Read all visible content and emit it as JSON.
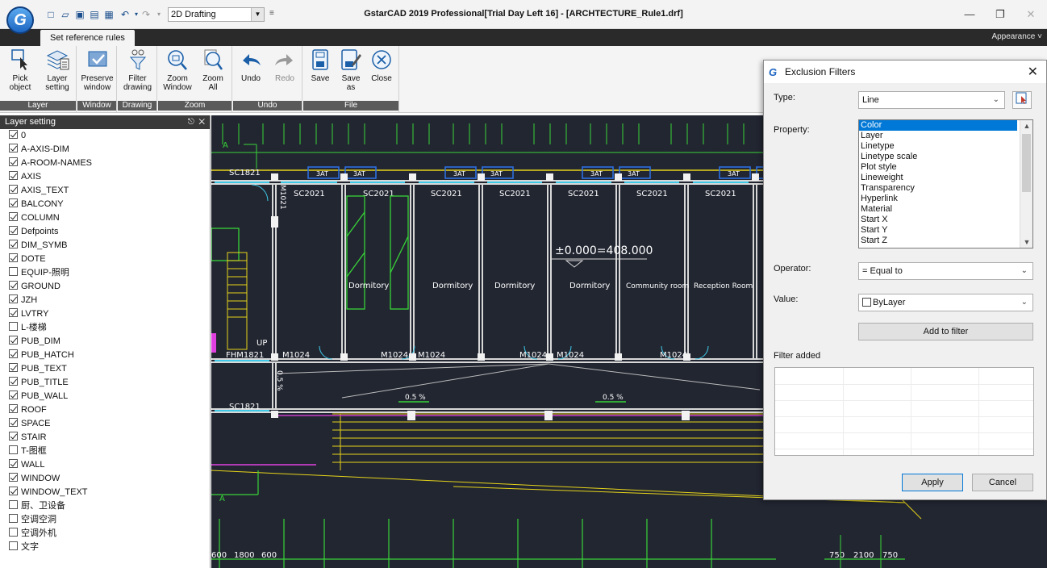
{
  "app": {
    "title": "GstarCAD 2019 Professional[Trial Day Left 16] - [ARCHTECTURE_Rule1.drf]",
    "logo_letter": "G",
    "workspace": "2D Drafting",
    "appearance": "Appearance"
  },
  "ribbon": {
    "active_tab": "Set reference rules",
    "groups": [
      {
        "label": "Layer",
        "buttons": [
          {
            "label": "Pick\nobject",
            "icon": "pick-object-icon"
          },
          {
            "label": "Layer\nsetting",
            "icon": "layer-setting-icon"
          }
        ]
      },
      {
        "label": "Window",
        "buttons": [
          {
            "label": "Preserve\nwindow",
            "icon": "preserve-window-icon"
          }
        ]
      },
      {
        "label": "Drawing",
        "buttons": [
          {
            "label": "Filter\ndrawing",
            "icon": "filter-drawing-icon"
          }
        ]
      },
      {
        "label": "Zoom",
        "buttons": [
          {
            "label": "Zoom\nWindow",
            "icon": "zoom-window-icon"
          },
          {
            "label": "Zoom\nAll",
            "icon": "zoom-all-icon"
          }
        ]
      },
      {
        "label": "Undo",
        "buttons": [
          {
            "label": "Undo",
            "icon": "undo-icon"
          },
          {
            "label": "Redo",
            "icon": "redo-icon"
          }
        ]
      },
      {
        "label": "File",
        "buttons": [
          {
            "label": "Save",
            "icon": "save-icon"
          },
          {
            "label": "Save\nas",
            "icon": "save-as-icon"
          },
          {
            "label": "Close",
            "icon": "close-circle-icon"
          }
        ]
      }
    ]
  },
  "layer_panel": {
    "title": "Layer setting",
    "controls": "➕ ✕",
    "layers": [
      {
        "name": "0",
        "checked": true
      },
      {
        "name": "A-AXIS-DIM",
        "checked": true
      },
      {
        "name": "A-ROOM-NAMES",
        "checked": true
      },
      {
        "name": "AXIS",
        "checked": true
      },
      {
        "name": "AXIS_TEXT",
        "checked": true
      },
      {
        "name": "BALCONY",
        "checked": true
      },
      {
        "name": "COLUMN",
        "checked": true
      },
      {
        "name": "Defpoints",
        "checked": true
      },
      {
        "name": "DIM_SYMB",
        "checked": true
      },
      {
        "name": "DOTE",
        "checked": true
      },
      {
        "name": "EQUIP-照明",
        "checked": false
      },
      {
        "name": "GROUND",
        "checked": true
      },
      {
        "name": "JZH",
        "checked": true
      },
      {
        "name": "LVTRY",
        "checked": true
      },
      {
        "name": "L-楼梯",
        "checked": false
      },
      {
        "name": "PUB_DIM",
        "checked": true
      },
      {
        "name": "PUB_HATCH",
        "checked": true
      },
      {
        "name": "PUB_TEXT",
        "checked": true
      },
      {
        "name": "PUB_TITLE",
        "checked": true
      },
      {
        "name": "PUB_WALL",
        "checked": true
      },
      {
        "name": "ROOF",
        "checked": true
      },
      {
        "name": "SPACE",
        "checked": true
      },
      {
        "name": "STAIR",
        "checked": true
      },
      {
        "name": "T-图框",
        "checked": false
      },
      {
        "name": "WALL",
        "checked": true
      },
      {
        "name": "WINDOW",
        "checked": true
      },
      {
        "name": "WINDOW_TEXT",
        "checked": true
      },
      {
        "name": "厨、卫设备",
        "checked": false
      },
      {
        "name": "空调空洞",
        "checked": false
      },
      {
        "name": "空调外机",
        "checked": false
      },
      {
        "name": "文字",
        "checked": false
      }
    ]
  },
  "drawing": {
    "axis_marks": [
      "A",
      "A"
    ],
    "window_labels_top": [
      "SC1821",
      "SC2021",
      "SC2021",
      "SC2021",
      "SC2021",
      "SC2021",
      "SC2021",
      "SC2021"
    ],
    "window_tags": [
      "3AT",
      "3AT",
      "3AT",
      "3AT",
      "3AT",
      "3AT",
      "3AT",
      "3AT"
    ],
    "vertical_label": "M1021",
    "elevation": "±0.000=408.000",
    "rooms": [
      "Dormitory",
      "Dormitory",
      "Dormitory",
      "Dormitory",
      "Community room",
      "Reception Room"
    ],
    "up_label": "UP",
    "door_labels": [
      "FHM1821",
      "M1024",
      "M1024",
      "M1024",
      "M1024",
      "M1024",
      "M1024"
    ],
    "slope_labels": [
      "0.5 %",
      "0.5 %",
      "0.5 %"
    ],
    "sc_bottom": "SC1821",
    "dims_bottom_left": [
      "600",
      "1800",
      "600"
    ],
    "dims_bottom_right": [
      "750",
      "2100",
      "750"
    ]
  },
  "dialog": {
    "title": "Exclusion Filters",
    "type_label": "Type:",
    "type_value": "Line",
    "property_label": "Property:",
    "properties": [
      "Color",
      "Layer",
      "Linetype",
      "Linetype scale",
      "Plot style",
      "Lineweight",
      "Transparency",
      "Hyperlink",
      "Material",
      "Start X",
      "Start Y",
      "Start Z"
    ],
    "selected_property": "Color",
    "operator_label": "Operator:",
    "operator_value": "= Equal to",
    "value_label": "Value:",
    "value_value": "ByLayer",
    "add_button": "Add to filter",
    "filter_added_label": "Filter added",
    "apply_button": "Apply",
    "cancel_button": "Cancel"
  }
}
